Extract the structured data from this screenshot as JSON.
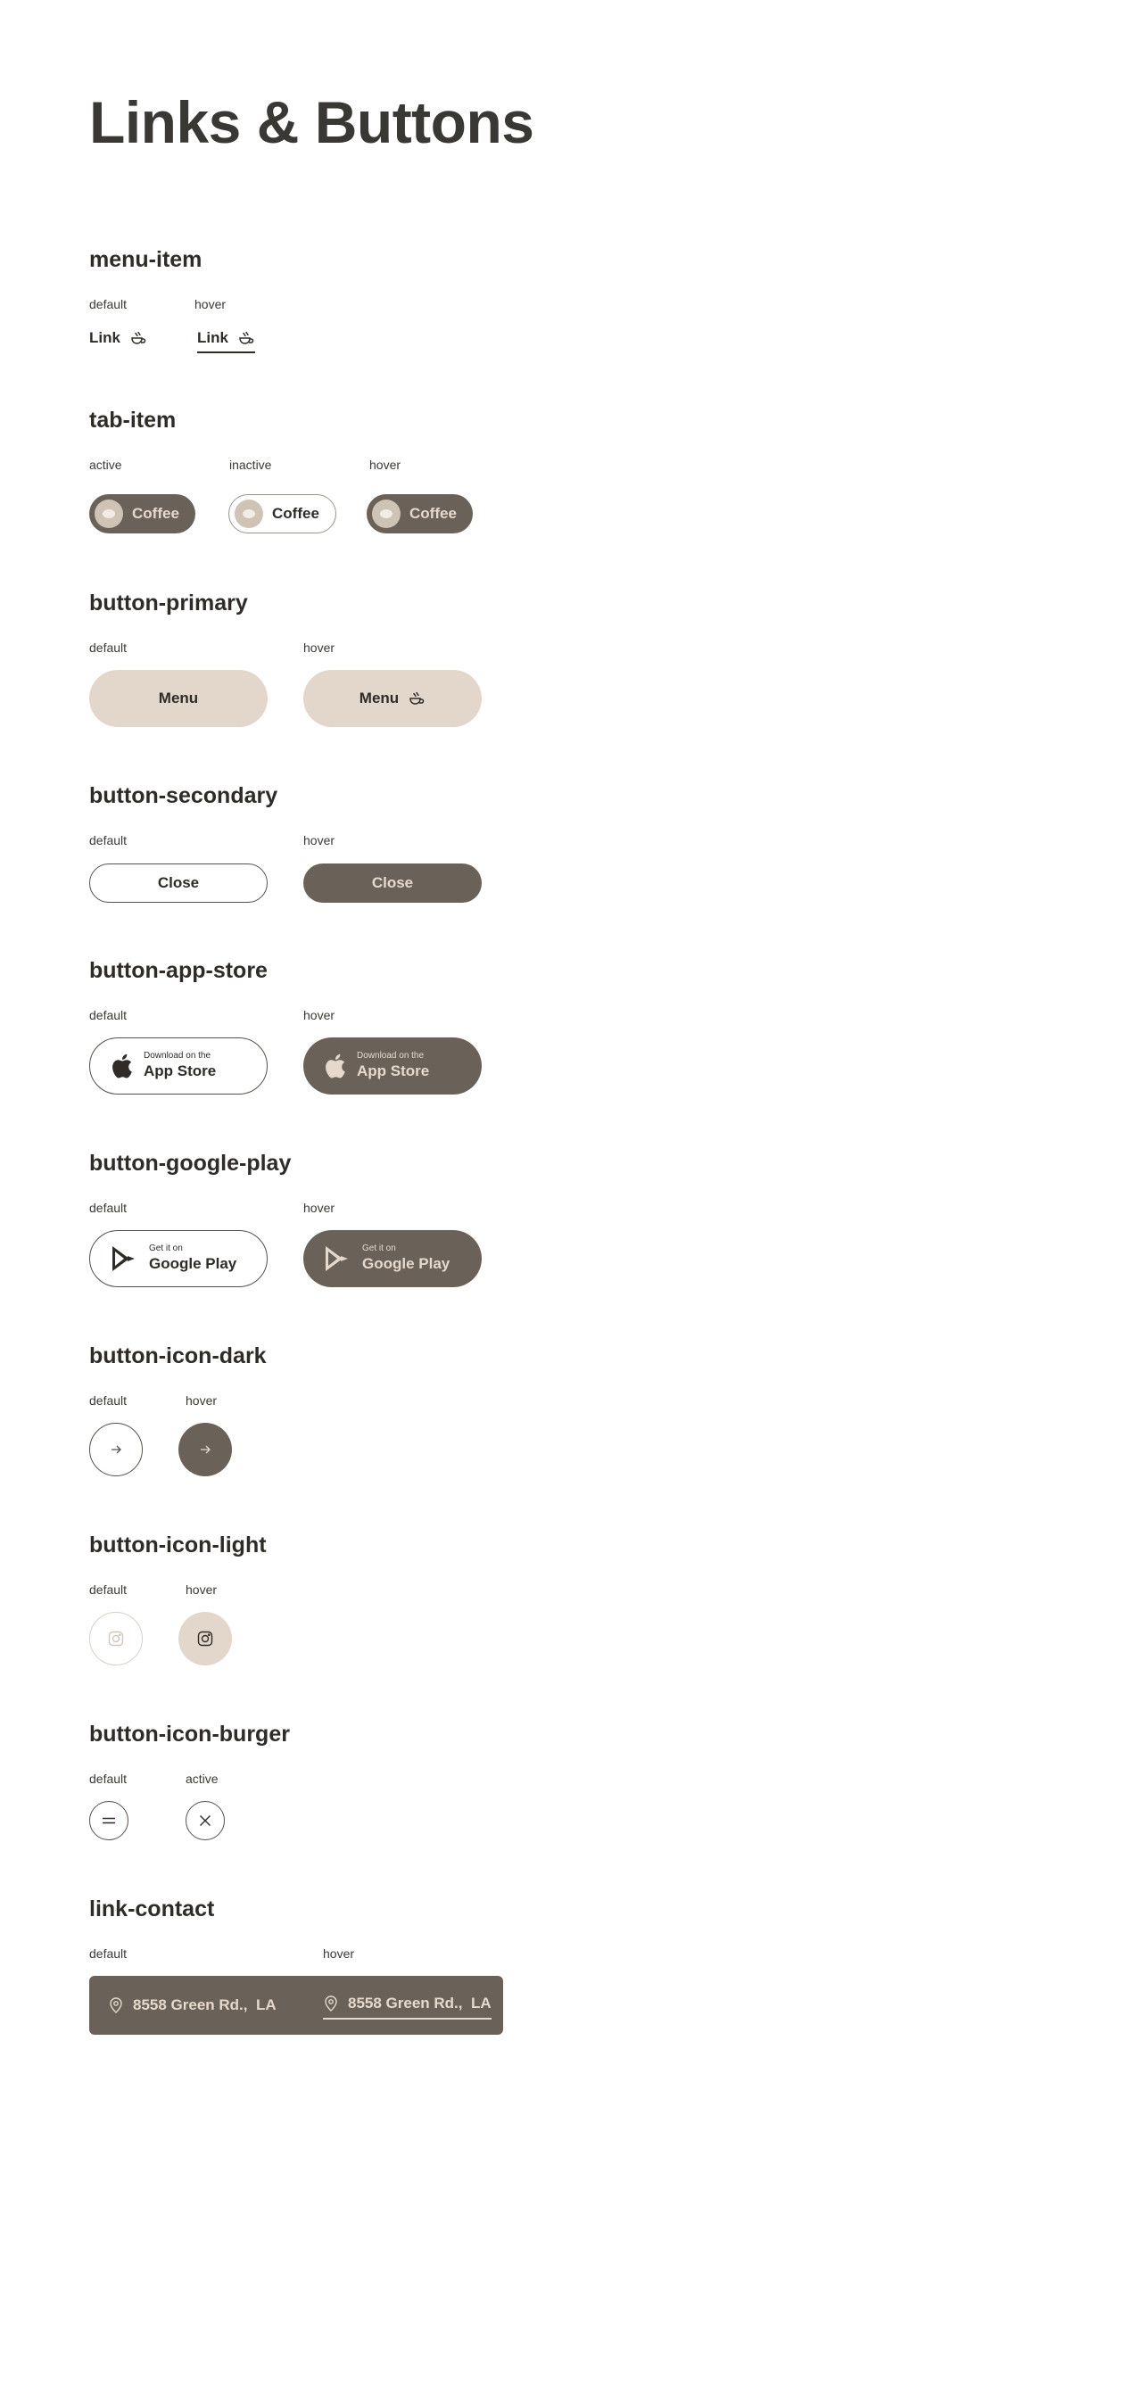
{
  "page": {
    "title": "Links & Buttons"
  },
  "colors": {
    "dark": "#6a6259",
    "beige": "#e3d6cb",
    "text": "#2f2c28"
  },
  "menu_item": {
    "name": "menu-item",
    "default_label": "default",
    "hover_label": "hover",
    "link_text": "Link",
    "icon": "coffee-icon"
  },
  "tab_item": {
    "name": "tab-item",
    "active_label": "active",
    "inactive_label": "inactive",
    "hover_label": "hover",
    "text": "Coffee"
  },
  "button_primary": {
    "name": "button-primary",
    "default_label": "default",
    "hover_label": "hover",
    "text": "Menu"
  },
  "button_secondary": {
    "name": "button-secondary",
    "default_label": "default",
    "hover_label": "hover",
    "text": "Close"
  },
  "button_app_store": {
    "name": "button-app-store",
    "default_label": "default",
    "hover_label": "hover",
    "small": "Download on the",
    "big": "App Store",
    "icon": "apple-icon"
  },
  "button_google_play": {
    "name": "button-google-play",
    "default_label": "default",
    "hover_label": "hover",
    "small": "Get it on",
    "big": "Google Play",
    "icon": "google-play-icon"
  },
  "button_icon_dark": {
    "name": "button-icon-dark",
    "default_label": "default",
    "hover_label": "hover",
    "icon": "arrow-right-icon"
  },
  "button_icon_light": {
    "name": "button-icon-light",
    "default_label": "default",
    "hover_label": "hover",
    "icon": "instagram-icon"
  },
  "button_icon_burger": {
    "name": "button-icon-burger",
    "default_label": "default",
    "active_label": "active",
    "icon_default": "burger-icon",
    "icon_active": "close-icon"
  },
  "link_contact": {
    "name": "link-contact",
    "default_label": "default",
    "hover_label": "hover",
    "address": "8558 Green Rd.,  LA",
    "icon": "location-pin-icon"
  }
}
